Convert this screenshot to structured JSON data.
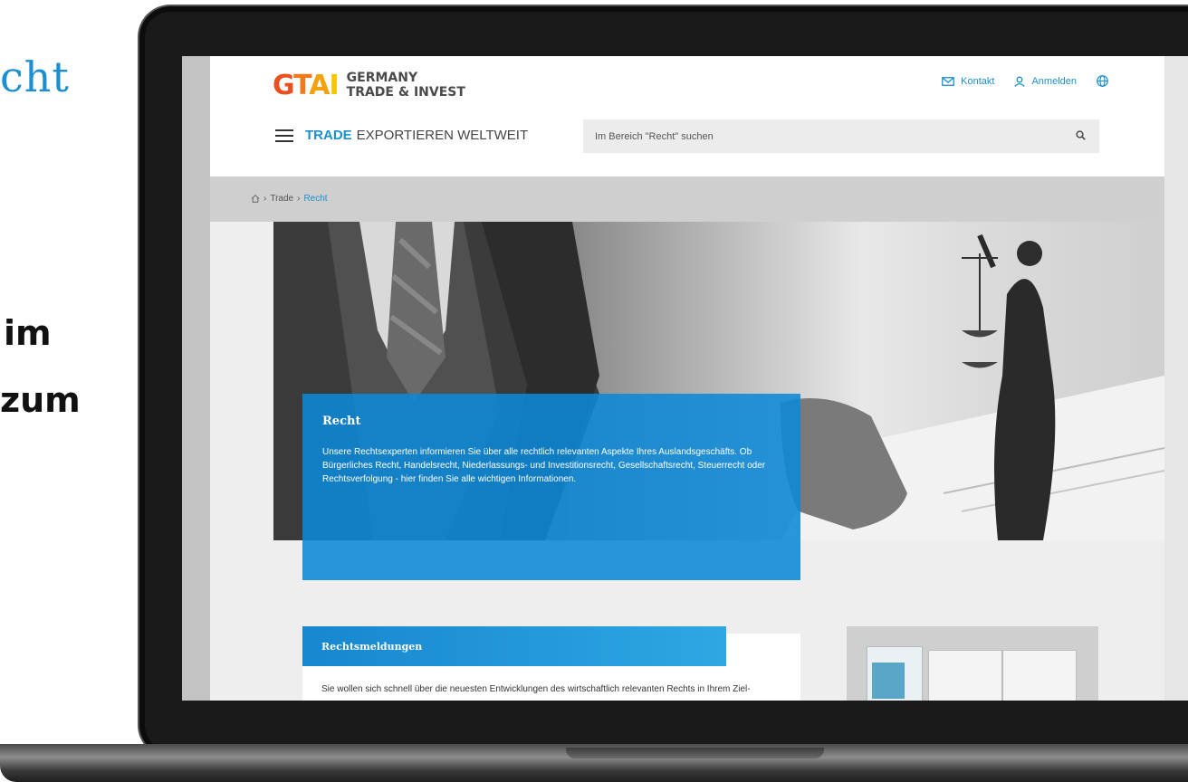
{
  "slide": {
    "heading_fragment": "cht",
    "bold_line_1": "im",
    "bold_line_2": "zum"
  },
  "header": {
    "logo": {
      "mark": "GTAI",
      "line1": "GERMANY",
      "line2": "TRADE & INVEST"
    },
    "util_nav": {
      "contact_label": "Kontakt",
      "login_label": "Anmelden",
      "language_icon": "globe-icon"
    },
    "brand": {
      "trade": "TRADE",
      "subtitle": "EXPORTIEREN WELTWEIT"
    },
    "search": {
      "placeholder": "Im Bereich \"Recht\" suchen"
    }
  },
  "breadcrumb": {
    "home_icon": "home-icon",
    "items": [
      "Trade",
      "Recht"
    ]
  },
  "hero": {
    "title": "Recht",
    "text": "Unsere Rechtsexperten informieren Sie über alle rechtlich relevanten Aspekte Ihres Auslandsgeschäfts. Ob Bürgerliches Recht, Handelsrecht, Niederlassungs- und Investitionsrecht, Gesellschaftsrecht, Steuerrecht oder Rechtsverfolgung - hier finden Sie alle wichtigen Informationen."
  },
  "news": {
    "title": "Rechtsmeldungen",
    "text": "Sie wollen sich schnell über die neuesten Entwicklungen des wirtschaftlich relevanten Rechts in Ihrem Ziel-"
  },
  "colors": {
    "accent": "#1b8fd0",
    "hero_card": "#0d88d6",
    "logo_orange": "#f07a1a"
  }
}
